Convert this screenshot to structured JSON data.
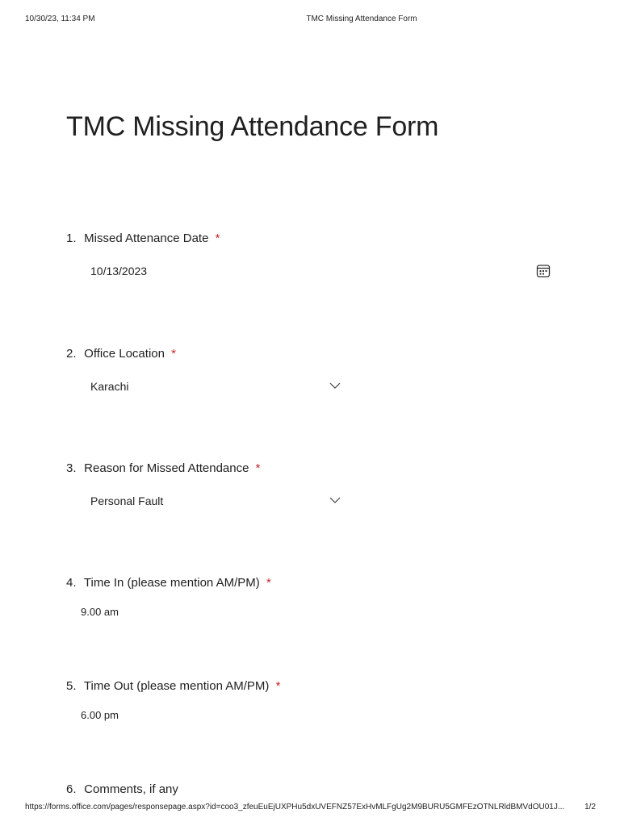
{
  "print_header": {
    "timestamp": "10/30/23, 11:34 PM",
    "title": "TMC Missing Attendance Form"
  },
  "form": {
    "title": "TMC Missing Attendance Form",
    "questions": [
      {
        "number": "1.",
        "label": "Missed Attenance Date",
        "required_mark": "*",
        "answer": "10/13/2023",
        "type": "date",
        "icon": "calendar-icon"
      },
      {
        "number": "2.",
        "label": "Office Location",
        "required_mark": "*",
        "answer": "Karachi",
        "type": "select",
        "icon": "chevron-down-icon"
      },
      {
        "number": "3.",
        "label": "Reason for Missed Attendance",
        "required_mark": "*",
        "answer": "Personal Fault",
        "type": "select",
        "icon": "chevron-down-icon"
      },
      {
        "number": "4.",
        "label": "Time In (please mention AM/PM)",
        "required_mark": "*",
        "answer": "9.00 am",
        "type": "text"
      },
      {
        "number": "5.",
        "label": "Time Out (please mention AM/PM)",
        "required_mark": "*",
        "answer": "6.00 pm",
        "type": "text"
      },
      {
        "number": "6.",
        "label": "Comments, if any",
        "type": "text"
      }
    ]
  },
  "print_footer": {
    "url": "https://forms.office.com/pages/responsepage.aspx?id=coo3_zfeuEuEjUXPHu5dxUVEFNZ57ExHvMLFgUg2M9BURU5GMFEzOTNLRldBMVdOU01J...",
    "page": "1/2"
  },
  "colors": {
    "required": "#c4262e",
    "text": "#1f1f1f"
  }
}
